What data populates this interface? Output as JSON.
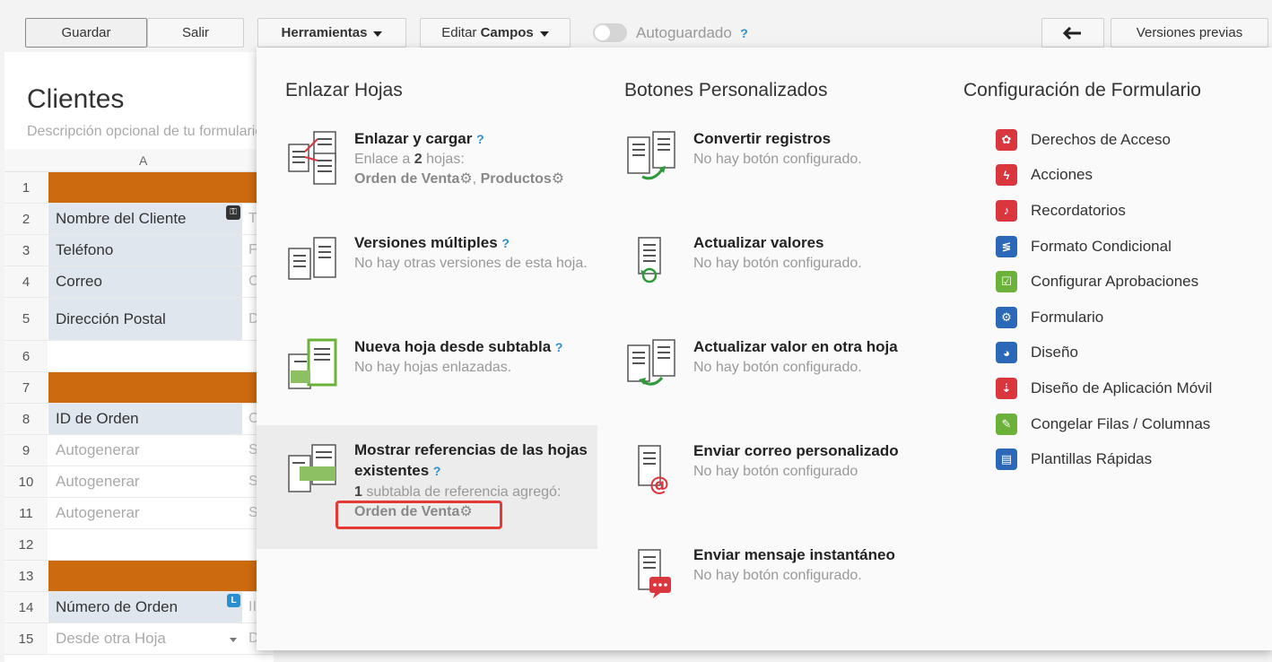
{
  "toolbar": {
    "save": "Guardar",
    "exit": "Salir",
    "tools": "Herramientas",
    "edit_prefix": "Editar",
    "edit_fields": "Campos",
    "autosave": "Autoguardado",
    "help": "?",
    "back_icon": "arrow-left-icon",
    "previous_versions": "Versiones previas"
  },
  "sheet": {
    "title": "Clientes",
    "description": "Descripción opcional de tu formulario",
    "column_header": "A",
    "rows": [
      {
        "num": "1",
        "type": "orange",
        "text": ""
      },
      {
        "num": "2",
        "type": "field",
        "text": "Nombre del Cliente",
        "side": "T"
      },
      {
        "num": "3",
        "type": "field",
        "text": "Teléfono",
        "side": "F"
      },
      {
        "num": "4",
        "type": "field",
        "text": "Correo",
        "side": "C"
      },
      {
        "num": "5",
        "type": "field",
        "text": "Dirección Postal",
        "side": "D"
      },
      {
        "num": "6",
        "type": "empty",
        "text": ""
      },
      {
        "num": "7",
        "type": "orange",
        "text": ""
      },
      {
        "num": "8",
        "type": "field",
        "text": "ID de Orden",
        "side": "C"
      },
      {
        "num": "9",
        "type": "auto",
        "text": "Autogenerar",
        "side": "S"
      },
      {
        "num": "10",
        "type": "auto",
        "text": "Autogenerar",
        "side": "S"
      },
      {
        "num": "11",
        "type": "auto",
        "text": "Autogenerar",
        "side": "S"
      },
      {
        "num": "12",
        "type": "empty",
        "text": ""
      },
      {
        "num": "13",
        "type": "orange",
        "text": ""
      },
      {
        "num": "14",
        "type": "field",
        "text": "Número de Orden",
        "side": "II"
      },
      {
        "num": "15",
        "type": "auto",
        "text": "Desde otra Hoja",
        "side": "D"
      }
    ],
    "key_badge": "⚿",
    "l_badge": "L"
  },
  "panel": {
    "col1_title": "Enlazar Hojas",
    "col2_title": "Botones Personalizados",
    "col3_title": "Configuración de Formulario",
    "link_load": {
      "title": "Enlazar y cargar",
      "desc_prefix": "Enlace a",
      "desc_count": "2",
      "desc_suffix": "hojas:",
      "sheet1": "Orden de Venta",
      "separator": ",",
      "sheet2": "Productos"
    },
    "multi_versions": {
      "title": "Versiones múltiples",
      "desc": "No hay otras versiones de esta hoja."
    },
    "new_sheet_subtable": {
      "title": "Nueva hoja desde subtabla",
      "desc": "No hay hojas enlazadas."
    },
    "show_refs": {
      "title": "Mostrar referencias de las hojas existentes",
      "desc_count": "1",
      "desc_suffix": "subtabla de referencia agregó:",
      "sheet": "Orden de Venta"
    },
    "convert_records": {
      "title": "Convertir registros",
      "desc": "No hay botón configurado."
    },
    "update_values": {
      "title": "Actualizar valores",
      "desc": "No hay botón configurado."
    },
    "update_other": {
      "title": "Actualizar valor en otra hoja",
      "desc": "No hay botón configurado."
    },
    "custom_email": {
      "title": "Enviar correo personalizado",
      "desc": "No hay botón configurado"
    },
    "instant_msg": {
      "title": "Enviar mensaje instantáneo",
      "desc": "No hay botón configurado."
    },
    "config_items": [
      {
        "label": "Derechos de Acceso",
        "color": "#d9363e",
        "glyph": "✿"
      },
      {
        "label": "Acciones",
        "color": "#d9363e",
        "glyph": "ϟ"
      },
      {
        "label": "Recordatorios",
        "color": "#d9363e",
        "glyph": "♪"
      },
      {
        "label": "Formato Condicional",
        "color": "#2b68b8",
        "glyph": "≶"
      },
      {
        "label": "Configurar Aprobaciones",
        "color": "#6bb13a",
        "glyph": "☑"
      },
      {
        "label": "Formulario",
        "color": "#2b68b8",
        "glyph": "⚙"
      },
      {
        "label": "Diseño",
        "color": "#2b68b8",
        "glyph": "◕"
      },
      {
        "label": "Diseño de Aplicación Móvil",
        "color": "#d9363e",
        "glyph": "⇣"
      },
      {
        "label": "Congelar Filas / Columnas",
        "color": "#6bb13a",
        "glyph": "✎"
      },
      {
        "label": "Plantillas Rápidas",
        "color": "#2b68b8",
        "glyph": "▤"
      }
    ]
  }
}
